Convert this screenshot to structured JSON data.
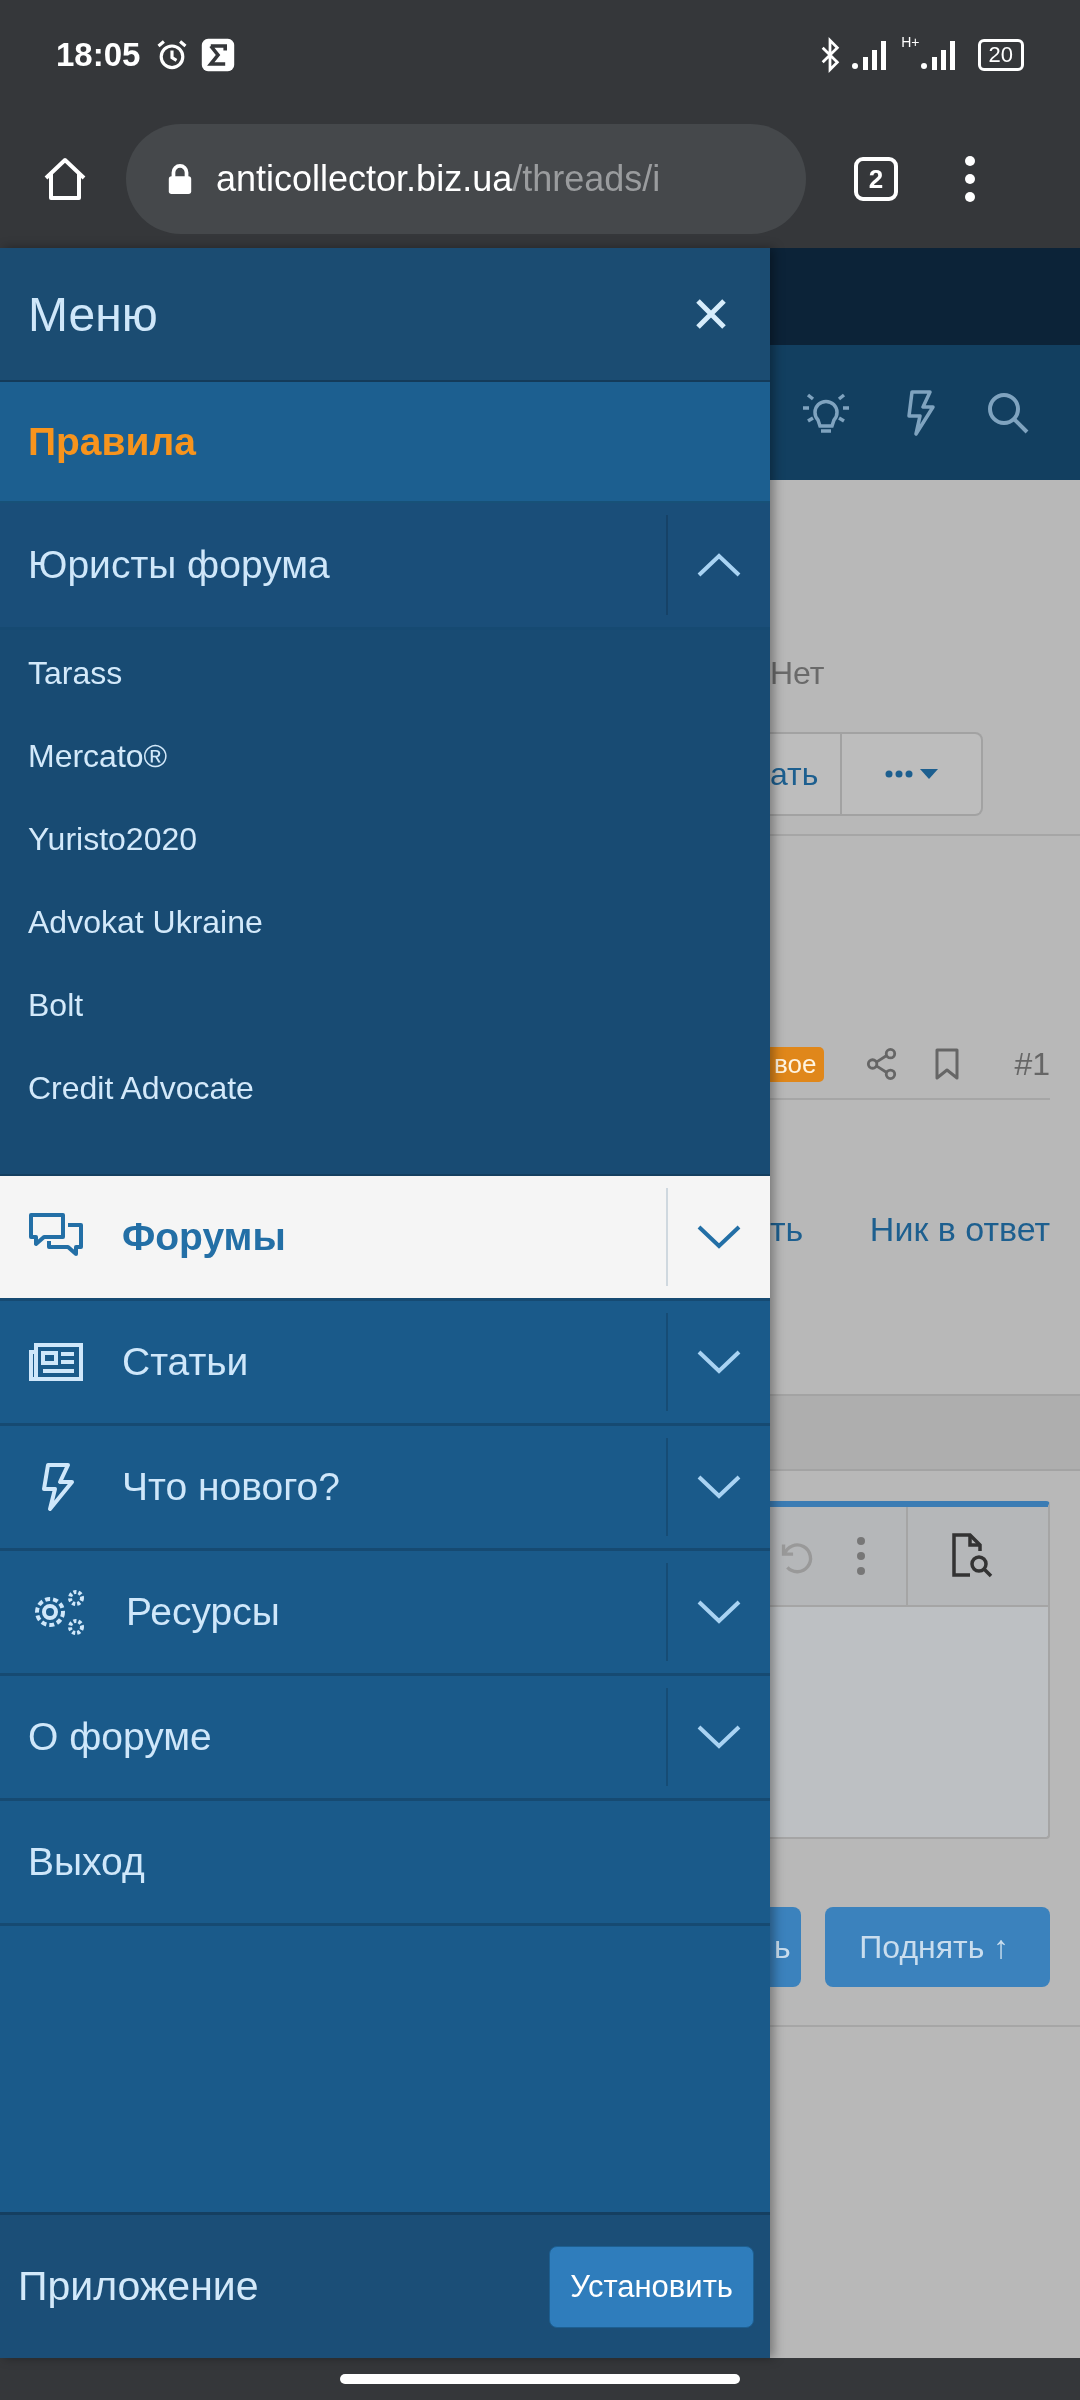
{
  "status_bar": {
    "time": "18:05",
    "network": "H+",
    "battery": "20"
  },
  "browser": {
    "url_domain": "anticollector.biz.ua",
    "url_path": "/threads/i",
    "tab_count": "2"
  },
  "menu": {
    "title": "Меню",
    "items": [
      {
        "kind": "featured",
        "label": "Правила"
      },
      {
        "kind": "group",
        "label": "Юристы форума",
        "expanded": true,
        "selected": false,
        "children": [
          {
            "label": "Tarass"
          },
          {
            "label": "Mercato®"
          },
          {
            "label": "Yuristo2020"
          },
          {
            "label": "Advokat Ukraine"
          },
          {
            "label": "Bolt"
          },
          {
            "label": "Credit Advocate"
          }
        ]
      },
      {
        "kind": "group",
        "label": "Форумы",
        "expanded": false,
        "selected": true
      },
      {
        "kind": "group",
        "label": "Статьи",
        "expanded": false,
        "selected": false
      },
      {
        "kind": "group",
        "label": "Что нового?",
        "expanded": false,
        "selected": false
      },
      {
        "kind": "group",
        "label": "Ресурсы",
        "expanded": false,
        "selected": false
      },
      {
        "kind": "group",
        "label": "О форуме",
        "expanded": false,
        "selected": false
      },
      {
        "kind": "link",
        "label": "Выход"
      }
    ],
    "footer": {
      "label": "Приложение",
      "button": "Установить"
    }
  },
  "page": {
    "poll_option": "Нет",
    "vote_button": "ать",
    "post_badge": "вое",
    "post_number": "#1",
    "reply_link": "ть",
    "quote_link": "Ник в ответ",
    "buttons": [
      "ь",
      "Поднять ↑"
    ]
  }
}
